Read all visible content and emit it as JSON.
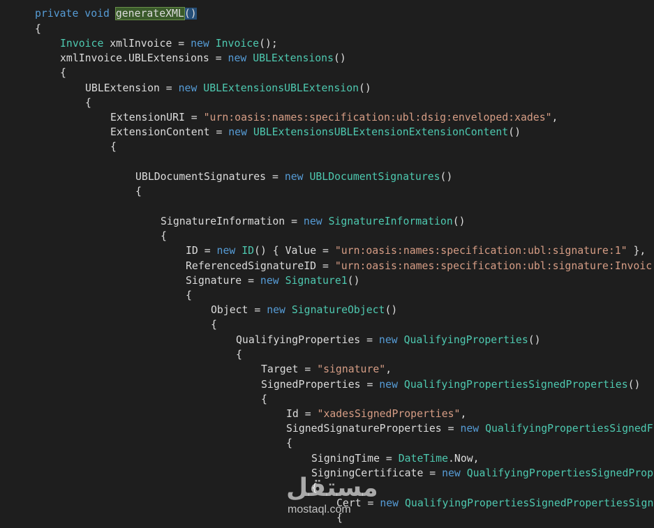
{
  "editor": {
    "lines": [
      {
        "indent": 1,
        "tokens": [
          {
            "t": "kw",
            "v": "private"
          },
          {
            "t": "plain",
            "v": " "
          },
          {
            "t": "kw",
            "v": "void"
          },
          {
            "t": "plain",
            "v": " "
          },
          {
            "t": "sel",
            "v": "generateXML"
          },
          {
            "t": "brace",
            "v": "()"
          }
        ]
      },
      {
        "indent": 1,
        "tokens": [
          {
            "t": "punc",
            "v": "{"
          }
        ]
      },
      {
        "indent": 2,
        "tokens": [
          {
            "t": "type",
            "v": "Invoice"
          },
          {
            "t": "plain",
            "v": " xmlInvoice = "
          },
          {
            "t": "kw",
            "v": "new"
          },
          {
            "t": "plain",
            "v": " "
          },
          {
            "t": "type",
            "v": "Invoice"
          },
          {
            "t": "punc",
            "v": "();"
          }
        ]
      },
      {
        "indent": 2,
        "tokens": [
          {
            "t": "plain",
            "v": "xmlInvoice.UBLExtensions = "
          },
          {
            "t": "kw",
            "v": "new"
          },
          {
            "t": "plain",
            "v": " "
          },
          {
            "t": "type",
            "v": "UBLExtensions"
          },
          {
            "t": "punc",
            "v": "()"
          }
        ]
      },
      {
        "indent": 2,
        "tokens": [
          {
            "t": "punc",
            "v": "{"
          }
        ]
      },
      {
        "indent": 3,
        "tokens": [
          {
            "t": "plain",
            "v": "UBLExtension = "
          },
          {
            "t": "kw",
            "v": "new"
          },
          {
            "t": "plain",
            "v": " "
          },
          {
            "t": "type",
            "v": "UBLExtensionsUBLExtension"
          },
          {
            "t": "punc",
            "v": "()"
          }
        ]
      },
      {
        "indent": 3,
        "tokens": [
          {
            "t": "punc",
            "v": "{"
          }
        ]
      },
      {
        "indent": 4,
        "tokens": [
          {
            "t": "plain",
            "v": "ExtensionURI = "
          },
          {
            "t": "str",
            "v": "\"urn:oasis:names:specification:ubl:dsig:enveloped:xades\""
          },
          {
            "t": "punc",
            "v": ","
          }
        ]
      },
      {
        "indent": 4,
        "tokens": [
          {
            "t": "plain",
            "v": "ExtensionContent = "
          },
          {
            "t": "kw",
            "v": "new"
          },
          {
            "t": "plain",
            "v": " "
          },
          {
            "t": "type",
            "v": "UBLExtensionsUBLExtensionExtensionContent"
          },
          {
            "t": "punc",
            "v": "()"
          }
        ]
      },
      {
        "indent": 4,
        "tokens": [
          {
            "t": "punc",
            "v": "{"
          }
        ]
      },
      {
        "indent": 0,
        "tokens": []
      },
      {
        "indent": 5,
        "tokens": [
          {
            "t": "plain",
            "v": "UBLDocumentSignatures = "
          },
          {
            "t": "kw",
            "v": "new"
          },
          {
            "t": "plain",
            "v": " "
          },
          {
            "t": "type",
            "v": "UBLDocumentSignatures"
          },
          {
            "t": "punc",
            "v": "()"
          }
        ]
      },
      {
        "indent": 5,
        "tokens": [
          {
            "t": "punc",
            "v": "{"
          }
        ]
      },
      {
        "indent": 0,
        "tokens": []
      },
      {
        "indent": 6,
        "tokens": [
          {
            "t": "plain",
            "v": "SignatureInformation = "
          },
          {
            "t": "kw",
            "v": "new"
          },
          {
            "t": "plain",
            "v": " "
          },
          {
            "t": "type",
            "v": "SignatureInformation"
          },
          {
            "t": "punc",
            "v": "()"
          }
        ]
      },
      {
        "indent": 6,
        "tokens": [
          {
            "t": "punc",
            "v": "{"
          }
        ]
      },
      {
        "indent": 7,
        "tokens": [
          {
            "t": "plain",
            "v": "ID = "
          },
          {
            "t": "kw",
            "v": "new"
          },
          {
            "t": "plain",
            "v": " "
          },
          {
            "t": "type",
            "v": "ID"
          },
          {
            "t": "punc",
            "v": "() { Value = "
          },
          {
            "t": "str",
            "v": "\"urn:oasis:names:specification:ubl:signature:1\""
          },
          {
            "t": "punc",
            "v": " },"
          }
        ]
      },
      {
        "indent": 7,
        "tokens": [
          {
            "t": "plain",
            "v": "ReferencedSignatureID = "
          },
          {
            "t": "str",
            "v": "\"urn:oasis:names:specification:ubl:signature:Invoic"
          }
        ]
      },
      {
        "indent": 7,
        "tokens": [
          {
            "t": "plain",
            "v": "Signature = "
          },
          {
            "t": "kw",
            "v": "new"
          },
          {
            "t": "plain",
            "v": " "
          },
          {
            "t": "type",
            "v": "Signature1"
          },
          {
            "t": "punc",
            "v": "()"
          }
        ]
      },
      {
        "indent": 7,
        "tokens": [
          {
            "t": "punc",
            "v": "{"
          }
        ]
      },
      {
        "indent": 8,
        "tokens": [
          {
            "t": "plain",
            "v": "Object = "
          },
          {
            "t": "kw",
            "v": "new"
          },
          {
            "t": "plain",
            "v": " "
          },
          {
            "t": "type",
            "v": "SignatureObject"
          },
          {
            "t": "punc",
            "v": "()"
          }
        ]
      },
      {
        "indent": 8,
        "tokens": [
          {
            "t": "punc",
            "v": "{"
          }
        ]
      },
      {
        "indent": 9,
        "tokens": [
          {
            "t": "plain",
            "v": "QualifyingProperties = "
          },
          {
            "t": "kw",
            "v": "new"
          },
          {
            "t": "plain",
            "v": " "
          },
          {
            "t": "type",
            "v": "QualifyingProperties"
          },
          {
            "t": "punc",
            "v": "()"
          }
        ]
      },
      {
        "indent": 9,
        "tokens": [
          {
            "t": "punc",
            "v": "{"
          }
        ]
      },
      {
        "indent": 10,
        "tokens": [
          {
            "t": "plain",
            "v": "Target = "
          },
          {
            "t": "str",
            "v": "\"signature\""
          },
          {
            "t": "punc",
            "v": ","
          }
        ]
      },
      {
        "indent": 10,
        "tokens": [
          {
            "t": "plain",
            "v": "SignedProperties = "
          },
          {
            "t": "kw",
            "v": "new"
          },
          {
            "t": "plain",
            "v": " "
          },
          {
            "t": "type",
            "v": "QualifyingPropertiesSignedProperties"
          },
          {
            "t": "punc",
            "v": "()"
          }
        ]
      },
      {
        "indent": 10,
        "tokens": [
          {
            "t": "punc",
            "v": "{"
          }
        ]
      },
      {
        "indent": 11,
        "tokens": [
          {
            "t": "plain",
            "v": "Id = "
          },
          {
            "t": "str",
            "v": "\"xadesSignedProperties\""
          },
          {
            "t": "punc",
            "v": ","
          }
        ]
      },
      {
        "indent": 11,
        "tokens": [
          {
            "t": "plain",
            "v": "SignedSignatureProperties = "
          },
          {
            "t": "kw",
            "v": "new"
          },
          {
            "t": "plain",
            "v": " "
          },
          {
            "t": "type",
            "v": "QualifyingPropertiesSignedF"
          }
        ]
      },
      {
        "indent": 11,
        "tokens": [
          {
            "t": "punc",
            "v": "{"
          }
        ]
      },
      {
        "indent": 12,
        "tokens": [
          {
            "t": "plain",
            "v": "SigningTime = "
          },
          {
            "t": "type",
            "v": "DateTime"
          },
          {
            "t": "plain",
            "v": ".Now,"
          }
        ]
      },
      {
        "indent": 12,
        "tokens": [
          {
            "t": "plain",
            "v": "SigningCertificate = "
          },
          {
            "t": "kw",
            "v": "new"
          },
          {
            "t": "plain",
            "v": " "
          },
          {
            "t": "type",
            "v": "QualifyingPropertiesSignedProp"
          }
        ]
      },
      {
        "indent": 12,
        "tokens": [
          {
            "t": "punc",
            "v": "{"
          }
        ]
      },
      {
        "indent": 13,
        "tokens": [
          {
            "t": "plain",
            "v": "Cert = "
          },
          {
            "t": "kw",
            "v": "new"
          },
          {
            "t": "plain",
            "v": " "
          },
          {
            "t": "type",
            "v": "QualifyingPropertiesSignedPropertiesSign"
          }
        ]
      },
      {
        "indent": 13,
        "tokens": [
          {
            "t": "punc",
            "v": "{"
          }
        ]
      }
    ]
  },
  "watermark": {
    "logo_text": "مستقل",
    "url_text": "mostaql.com"
  }
}
